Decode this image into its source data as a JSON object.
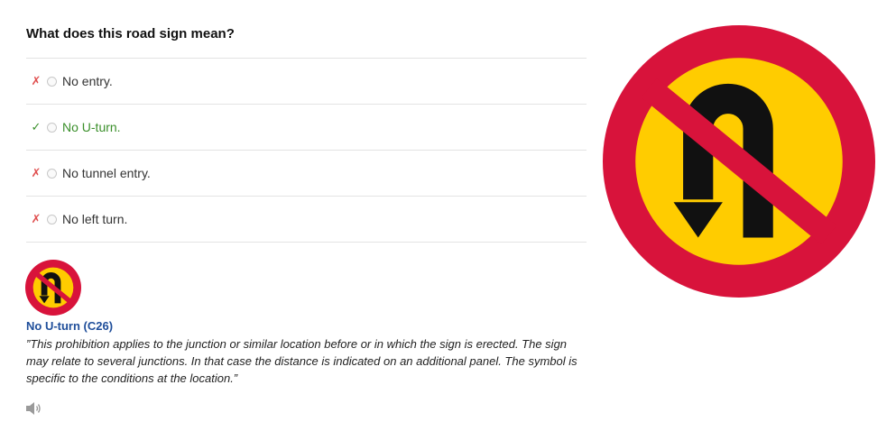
{
  "question": {
    "title": "What does this road sign mean?"
  },
  "options": [
    {
      "label": "No entry.",
      "status": "wrong",
      "mark": "✗"
    },
    {
      "label": "No U-turn.",
      "status": "correct",
      "mark": "✓"
    },
    {
      "label": "No tunnel entry.",
      "status": "wrong",
      "mark": "✗"
    },
    {
      "label": "No left turn.",
      "status": "wrong",
      "mark": "✗"
    }
  ],
  "sign": {
    "name": "No U-turn (C26)",
    "description": "”This prohibition applies to the junction or similar location before or in which the sign is erected. The sign may relate to several junctions. In that case the distance is indicated on an additional panel. The symbol is specific to the conditions at the location.”"
  },
  "colors": {
    "ring_red": "#d8133b",
    "fill_yellow": "#ffcc00",
    "symbol_black": "#111111",
    "correct_green": "#3a8f2a",
    "wrong_red": "#e05050",
    "link_blue": "#1f4e9a"
  },
  "icons": {
    "speaker": "speaker-icon",
    "sign": "no-u-turn-sign"
  }
}
